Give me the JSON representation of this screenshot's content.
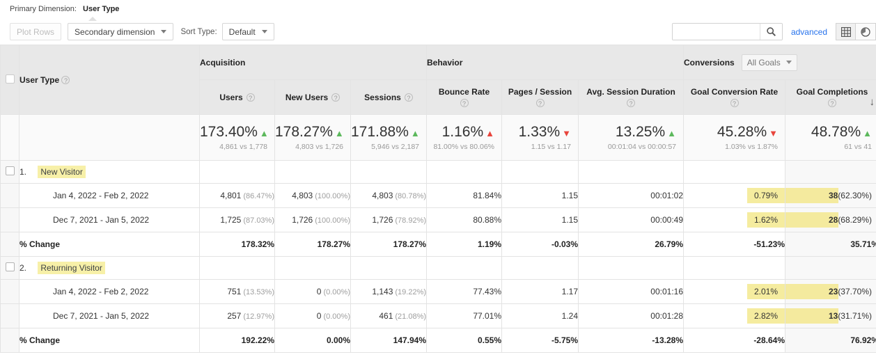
{
  "primary_dimension": {
    "label": "Primary Dimension:",
    "value": "User Type"
  },
  "toolbar": {
    "plot_rows": "Plot Rows",
    "secondary_dimension": "Secondary dimension",
    "sort_type_label": "Sort Type:",
    "sort_type_value": "Default",
    "search_value": "",
    "search_placeholder": "",
    "search_icon": "search-icon",
    "advanced": "advanced",
    "view_table_icon": "table-grid-icon",
    "view_pie_icon": "pie-chart-icon"
  },
  "table": {
    "dimension_header": "User Type",
    "groups": [
      {
        "label": "Acquisition"
      },
      {
        "label": "Behavior"
      },
      {
        "label": "Conversions",
        "dropdown": "All Goals"
      }
    ],
    "metrics": [
      {
        "label": "Users"
      },
      {
        "label": "New Users"
      },
      {
        "label": "Sessions"
      },
      {
        "label": "Bounce Rate"
      },
      {
        "label": "Pages / Session"
      },
      {
        "label": "Avg. Session Duration"
      },
      {
        "label": "Goal Conversion Rate"
      },
      {
        "label": "Goal Completions",
        "sort": "desc"
      }
    ],
    "summary": [
      {
        "value": "173.40%",
        "delta": "up-good",
        "sub": "4,861 vs 1,778"
      },
      {
        "value": "178.27%",
        "delta": "up-good",
        "sub": "4,803 vs 1,726"
      },
      {
        "value": "171.88%",
        "delta": "up-good",
        "sub": "5,946 vs 2,187"
      },
      {
        "value": "1.16%",
        "delta": "up-bad",
        "sub": "81.00% vs 80.06%"
      },
      {
        "value": "1.33%",
        "delta": "dn-bad",
        "sub": "1.15 vs 1.17"
      },
      {
        "value": "13.25%",
        "delta": "up-good",
        "sub": "00:01:04 vs 00:00:57"
      },
      {
        "value": "45.28%",
        "delta": "dn-bad",
        "sub": "1.03% vs 1.87%"
      },
      {
        "value": "48.78%",
        "delta": "up-good",
        "sub": "61 vs 41"
      }
    ],
    "rows": [
      {
        "index": "1.",
        "name": "New Visitor",
        "periods": [
          {
            "label": "Jan 4, 2022 - Feb 2, 2022",
            "users": "4,801",
            "users_pct": "(86.47%)",
            "new_users": "4,803",
            "new_users_pct": "(100.00%)",
            "sessions": "4,803",
            "sessions_pct": "(80.78%)",
            "bounce_rate": "81.84%",
            "pages_session": "1.15",
            "avg_duration": "00:01:02",
            "goal_rate": "0.79%",
            "goal_rate_bar": 37,
            "goal_completions": "38",
            "goal_completions_pct": "(62.30%)",
            "goal_completions_bar": 62
          },
          {
            "label": "Dec 7, 2021 - Jan 5, 2022",
            "users": "1,725",
            "users_pct": "(87.03%)",
            "new_users": "1,726",
            "new_users_pct": "(100.00%)",
            "sessions": "1,726",
            "sessions_pct": "(78.92%)",
            "bounce_rate": "80.88%",
            "pages_session": "1.15",
            "avg_duration": "00:00:49",
            "goal_rate": "1.62%",
            "goal_rate_bar": 37,
            "goal_completions": "28",
            "goal_completions_pct": "(68.29%)",
            "goal_completions_bar": 62
          }
        ],
        "change": {
          "label": "% Change",
          "users": "178.32%",
          "new_users": "178.27%",
          "sessions": "178.27%",
          "bounce_rate": "1.19%",
          "pages_session": "-0.03%",
          "avg_duration": "26.79%",
          "goal_rate": "-51.23%",
          "goal_completions": "35.71%"
        }
      },
      {
        "index": "2.",
        "name": "Returning Visitor",
        "periods": [
          {
            "label": "Jan 4, 2022 - Feb 2, 2022",
            "users": "751",
            "users_pct": "(13.53%)",
            "new_users": "0",
            "new_users_pct": "(0.00%)",
            "sessions": "1,143",
            "sessions_pct": "(19.22%)",
            "bounce_rate": "77.43%",
            "pages_session": "1.17",
            "avg_duration": "00:01:16",
            "goal_rate": "2.01%",
            "goal_rate_bar": 37,
            "goal_completions": "23",
            "goal_completions_pct": "(37.70%)",
            "goal_completions_bar": 62
          },
          {
            "label": "Dec 7, 2021 - Jan 5, 2022",
            "users": "257",
            "users_pct": "(12.97%)",
            "new_users": "0",
            "new_users_pct": "(0.00%)",
            "sessions": "461",
            "sessions_pct": "(21.08%)",
            "bounce_rate": "77.01%",
            "pages_session": "1.24",
            "avg_duration": "00:01:28",
            "goal_rate": "2.82%",
            "goal_rate_bar": 37,
            "goal_completions": "13",
            "goal_completions_pct": "(31.71%)",
            "goal_completions_bar": 62
          }
        ],
        "change": {
          "label": "% Change",
          "users": "192.22%",
          "new_users": "0.00%",
          "sessions": "147.94%",
          "bounce_rate": "0.55%",
          "pages_session": "-5.75%",
          "avg_duration": "-13.28%",
          "goal_rate": "-28.64%",
          "goal_completions": "76.92%"
        }
      }
    ],
    "help_icon": "help-question-icon"
  },
  "colors": {
    "positive": "#5cb85c",
    "negative": "#e8453c",
    "highlight": "#f5ec9f",
    "link": "#2672ec",
    "header_bg": "#e8e8e8"
  }
}
